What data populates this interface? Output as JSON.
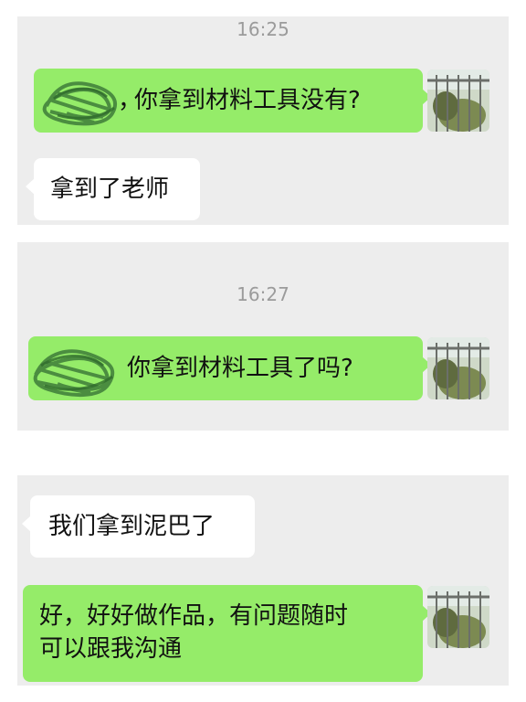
{
  "panel1": {
    "timestamp": "16:25",
    "messages": [
      {
        "sender": "self",
        "text": "你拿到材料工具没有?"
      },
      {
        "sender": "other",
        "text": "拿到了老师"
      }
    ]
  },
  "panel2": {
    "timestamp": "16:27",
    "messages": [
      {
        "sender": "self",
        "text": "你拿到材料工具了吗?"
      }
    ]
  },
  "panel3": {
    "messages": [
      {
        "sender": "other",
        "text": "我们拿到泥巴了"
      },
      {
        "sender": "self",
        "lines": [
          "好，好好做作品，有问题随时",
          "可以跟我沟通"
        ]
      }
    ]
  },
  "colors": {
    "outgoing_bubble": "#95ec69",
    "incoming_bubble": "#ffffff",
    "chat_background": "#ededed",
    "timestamp_text": "#9b9b9b"
  },
  "icons": [
    "avatar",
    "redaction-scribble"
  ]
}
